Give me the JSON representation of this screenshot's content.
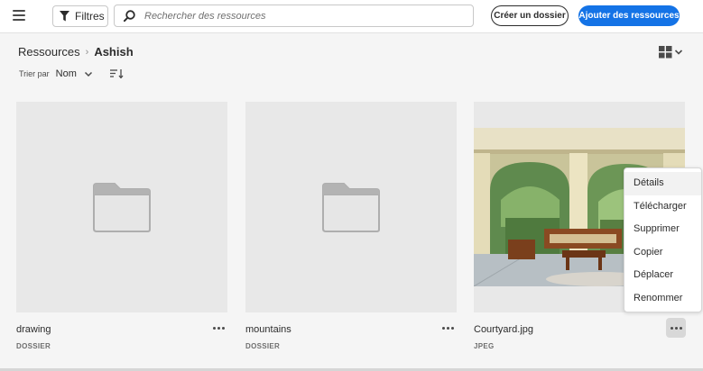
{
  "header": {
    "filter_label": "Filtres",
    "search_placeholder": "Rechercher des ressources",
    "create_folder_label": "Créer un dossier",
    "add_assets_label": "Ajouter des ressources",
    "accent": "#1473e6"
  },
  "breadcrumb": {
    "root": "Ressources",
    "current": "Ashish"
  },
  "sort": {
    "label": "Trier par",
    "value": "Nom"
  },
  "assets": [
    {
      "name": "drawing",
      "type": "DOSSIER",
      "icon": "folder-icon"
    },
    {
      "name": "mountains",
      "type": "DOSSIER",
      "icon": "folder-icon"
    },
    {
      "name": "Courtyard.jpg",
      "type": "JPEG",
      "icon": "image-thumbnail"
    }
  ],
  "context_menu": {
    "items": [
      "Détails",
      "Télécharger",
      "Supprimer",
      "Copier",
      "Déplacer",
      "Renommer"
    ]
  }
}
